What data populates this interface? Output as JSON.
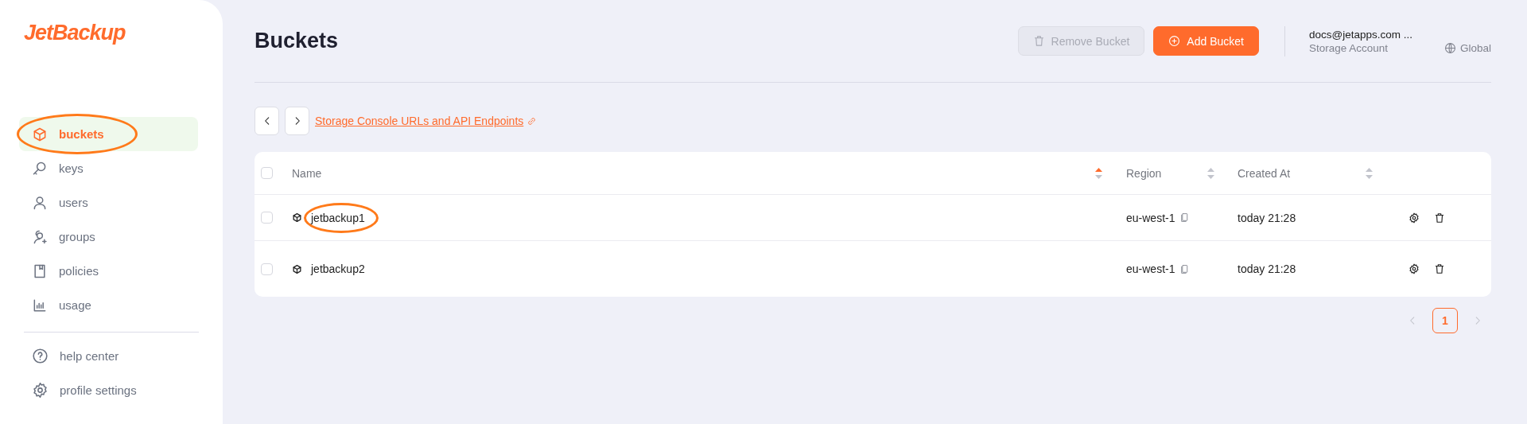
{
  "logo": {
    "text": "JetBackup"
  },
  "sidebar": {
    "items": [
      {
        "label": "buckets",
        "selected": true,
        "circled": true
      },
      {
        "label": "keys",
        "selected": false,
        "circled": false
      },
      {
        "label": "users",
        "selected": false,
        "circled": false
      },
      {
        "label": "groups",
        "selected": false,
        "circled": false
      },
      {
        "label": "policies",
        "selected": false,
        "circled": false
      },
      {
        "label": "usage",
        "selected": false,
        "circled": false
      }
    ],
    "footer_items": [
      {
        "label": "help center"
      },
      {
        "label": "profile settings"
      }
    ]
  },
  "header": {
    "title": "Buckets",
    "buttons": [
      {
        "label": "Remove Bucket",
        "kind": "secondary",
        "disabled": true
      },
      {
        "label": "Add Bucket",
        "kind": "primary",
        "disabled": false
      }
    ],
    "account": {
      "email": "docs@jetapps.com ...",
      "role": "Storage Account",
      "region": "Global"
    }
  },
  "toolbar": {
    "link": "Storage Console URLs and API Endpoints"
  },
  "table": {
    "select_all_checked": false,
    "columns": [
      {
        "label": "Name",
        "sort_active": true
      },
      {
        "label": "Region",
        "sort_active": false
      },
      {
        "label": "Created At",
        "sort_active": false
      }
    ],
    "rows": [
      {
        "checked": false,
        "name": "jetbackup1",
        "region": "eu-west-1",
        "created": "today 21:28",
        "circled": true
      },
      {
        "checked": false,
        "name": "jetbackup2",
        "region": "eu-west-1",
        "created": "today 21:28",
        "circled": false
      }
    ]
  },
  "pagination": {
    "pages": [
      {
        "label": "1",
        "selected": true
      }
    ]
  }
}
